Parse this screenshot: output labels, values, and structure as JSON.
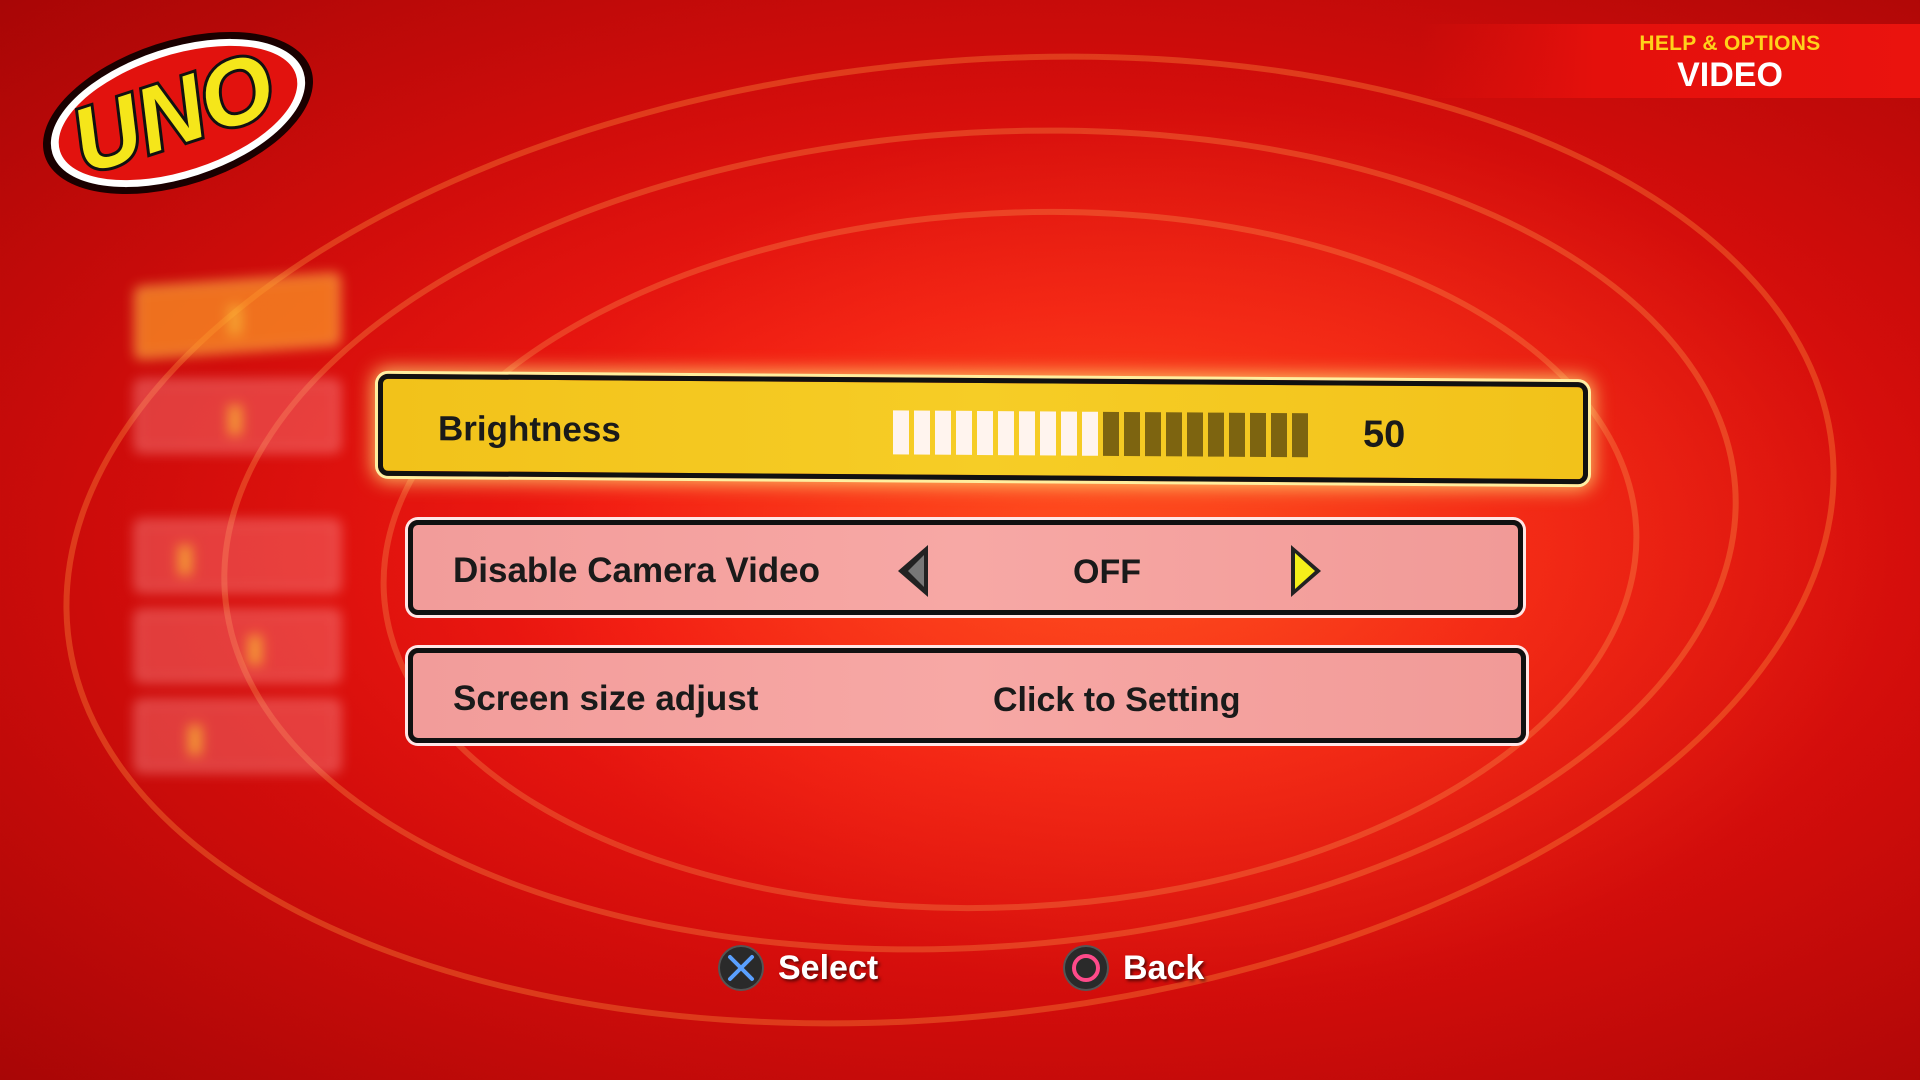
{
  "header": {
    "section": "HELP & OPTIONS",
    "title": "VIDEO"
  },
  "logo": {
    "text": "UNO"
  },
  "options": {
    "brightness": {
      "label": "Brightness",
      "value": "50",
      "level_fraction": 0.5,
      "segments_total": 20
    },
    "camera": {
      "label": "Disable Camera Video",
      "value": "OFF"
    },
    "screen": {
      "label": "Screen size adjust",
      "value": "Click to Setting"
    }
  },
  "prompts": {
    "select": {
      "label": "Select",
      "icon": "cross-button-icon"
    },
    "back": {
      "label": "Back",
      "icon": "circle-button-icon"
    }
  },
  "colors": {
    "background": "#e5140f",
    "selected_row": "#f4c520",
    "row": "#f4a09e",
    "header_sub": "#ffd21a",
    "cross_icon": "#5aa0ff",
    "circle_icon": "#ff4a8a"
  }
}
